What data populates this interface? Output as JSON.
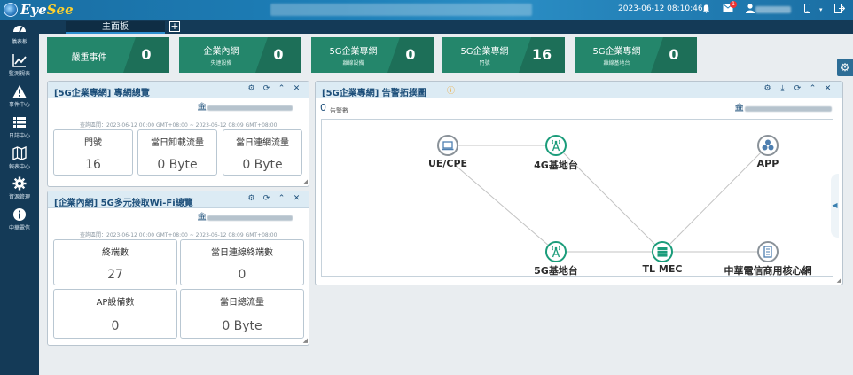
{
  "app": {
    "brand_a": "Eye",
    "brand_b": "See"
  },
  "topbar": {
    "datetime": "2023-06-12 08:10:46",
    "mail_count": "1",
    "icons": [
      "bell-icon",
      "mail-icon",
      "user-icon",
      "mobile-icon",
      "export-icon"
    ]
  },
  "sidebar": {
    "items": [
      {
        "label": "儀表板",
        "icon": "dashboard-icon"
      },
      {
        "label": "監測視表",
        "icon": "chart-line-icon"
      },
      {
        "label": "事件中心",
        "icon": "warning-icon"
      },
      {
        "label": "日誌中心",
        "icon": "list-icon"
      },
      {
        "label": "報表中心",
        "icon": "map-icon"
      },
      {
        "label": "資源管理",
        "icon": "gear-icon"
      },
      {
        "label": "中華電信",
        "icon": "info-icon"
      }
    ]
  },
  "tabs": {
    "main": "主面板",
    "add": "+"
  },
  "tiles": [
    {
      "title": "嚴重事件",
      "sub": "",
      "value": "0"
    },
    {
      "title": "企業內網",
      "sub": "失連設備",
      "value": "0"
    },
    {
      "title": "5G企業專網",
      "sub": "離線設備",
      "value": "0"
    },
    {
      "title": "5G企業專網",
      "sub": "門號",
      "value": "16"
    },
    {
      "title": "5G企業專網",
      "sub": "離線基地台",
      "value": "0"
    }
  ],
  "panel1": {
    "title": "[5G企業專網] 專網總覽",
    "range": "查詢區間：2023-06-12 00:00 GMT+08:00 ~ 2023-06-12 08:09 GMT+08:00",
    "stats": [
      {
        "label": "門號",
        "value": "16"
      },
      {
        "label": "當日卸載流量",
        "value": "0 Byte"
      },
      {
        "label": "當日連網流量",
        "value": "0 Byte"
      }
    ]
  },
  "panel2": {
    "title": "[企業內網] 5G多元接取Wi-Fi總覽",
    "range": "查詢區間：2023-06-12 00:00 GMT+08:00 ~ 2023-06-12 08:09 GMT+08:00",
    "stats": [
      {
        "label": "終端數",
        "value": "27"
      },
      {
        "label": "當日連線終端數",
        "value": "0"
      },
      {
        "label": "AP設備數",
        "value": "0"
      },
      {
        "label": "當日總流量",
        "value": "0 Byte"
      }
    ]
  },
  "panel3": {
    "title": "[5G企業專網] 告警拓撲圖",
    "alarm_count": "0",
    "alarm_label": "告警數",
    "nodes": [
      {
        "label": "UE/CPE",
        "icon": "laptop-icon"
      },
      {
        "label": "4G基地台",
        "icon": "antenna-icon"
      },
      {
        "label": "APP",
        "icon": "app-cluster-icon"
      },
      {
        "label": "5G基地台",
        "icon": "antenna-icon"
      },
      {
        "label": "TL MEC",
        "icon": "server-icon"
      },
      {
        "label": "中華電信商用核心網",
        "icon": "building-icon"
      }
    ]
  },
  "colors": {
    "tile_green": "#24866b",
    "tile_green_dark": "#1d6f58",
    "sidebar": "#143a57",
    "topbar": "#1d7fb8",
    "panel_header": "#dcebf4",
    "node_green": "#1a9c7a",
    "node_gray": "#8a9299"
  }
}
